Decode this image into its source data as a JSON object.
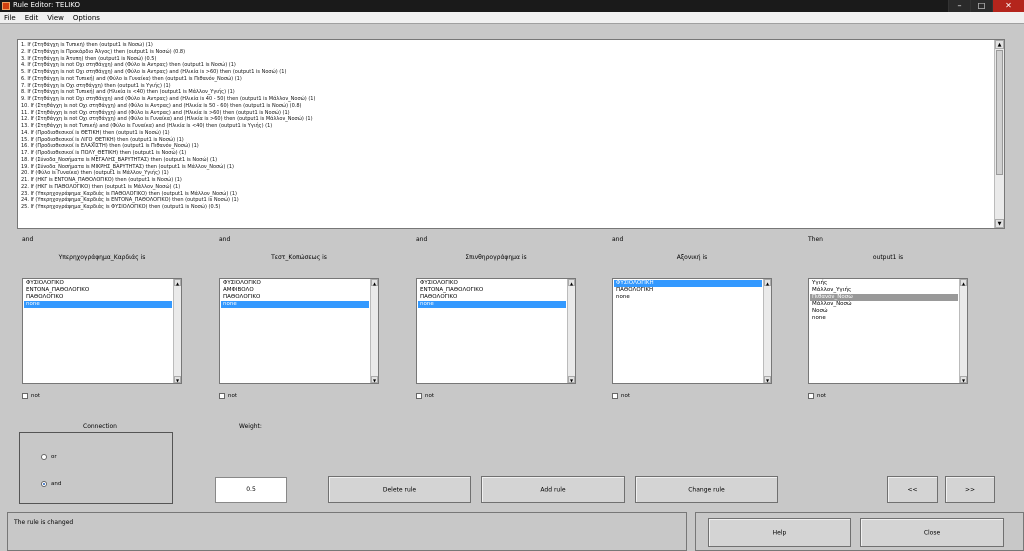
{
  "window": {
    "title": "Rule Editor: TELIKO",
    "min": "–",
    "max": "□",
    "close": "✕"
  },
  "menu": [
    "File",
    "Edit",
    "View",
    "Options"
  ],
  "rules": [
    "1. If (Στηθάγχη is Τυπική) then (output1 is Νοσώ) (1)",
    "2. If (Στηθάγχη is Προκάρδιο Άλγος) then (output1 is Νοσώ) (0.8)",
    "3. If (Στηθάγχη is Άτυπη) then (output1 is Νοσώ) (0.5)",
    "4. If (Στηθάγχη is not Οχι στηθάγχη) and (Φύλο is Αντρας) then (output1 is Νοσώ) (1)",
    "5. If (Στηθάγχη is not Οχι στηθάγχη) and (Φύλο is Αντρας) and (Ηλικία is >60) then (output1 is Νοσώ) (1)",
    "6. If (Στηθάγχη is not Τυπική) and (Φύλο is Γυναίκα) then (output1 is Πιθανόν_Νοσώ) (1)",
    "7. If (Στηθάγχη is Οχι στηθάγχη) then (output1 is Υγιής) (1)",
    "8. If (Στηθάγχη is not Τυπική) and (Ηλικία is <40) then (output1 is Μάλλον_Υγιής) (1)",
    "9. If (Στηθάγχη is not Οχι στηθάγχη) and (Φύλο is Αντρας) and (Ηλικία is 40 - 50) then (output1 is Μάλλον_Νοσώ) (1)",
    "10. If (Στηθάγχη is not Οχι στηθάγχη) and (Φύλο is Αντρας) and (Ηλικία is 50 - 60) then (output1 is Νοσώ) (0.8)",
    "11. If (Στηθάγχη is not Οχι στηθάγχη) and (Φύλο is Αντρας) and (Ηλικία is >60) then (output1 is Νοσώ) (1)",
    "12. If (Στηθάγχη is not Οχι στηθάγχη) and (Φύλο is Γυναίκα) and (Ηλικία is >60) then (output1 is Μάλλον_Νοσώ) (1)",
    "13. If (Στηθάγχη is not Τυπική) and (Φύλο is Γυναίκα) and (Ηλικία is <40) then (output1 is Υγιής) (1)",
    "14. If (Προδιαθεσικοί is ΘΕΤΙΚΗ) then (output1 is Νοσώ) (1)",
    "15. If (Προδιαθεσικοί is ΛΙΓΟ_ΘΕΤΙΚΗ) then (output1 is Νοσώ) (1)",
    "16. If (Προδιαθεσικοί is ΕΛΑΧΙΣΤΗ) then (output1 is Πιθανόν_Νοσώ) (1)",
    "17. If (Προδιαθεσικοί is ΠΟΛΥ_ΘΕΤΙΚΗ) then (output1 is Νοσώ) (1)",
    "18. If (Σύνοδα_Νοσήματα is ΜΕΓΑΛΗΣ_ΒΑΡΥΤΗΤΑΣ) then (output1 is Νοσώ) (1)",
    "19. If (Σύνοδα_Νοσήματα is ΜΙΚΡΗΣ_ΒΑΡΥΤΗΤΑΣ) then (output1 is Μάλλον_Νοσώ) (1)",
    "20. If (Φύλο is Γυναίκα) then (output1 is Μάλλον_Υγιής) (1)",
    "21. If (ΗΚΓ is ΕΝΤΟΝΑ_ΠΑΘΟΛΟΓΙΚΟ) then (output1 is Νοσώ) (1)",
    "22. If (ΗΚΓ is ΠΑΘΟΛΟΓΙΚΟ) then (output1 is Μάλλον_Νοσώ) (1)",
    "23. If (Υπερηχογράφημα_Καρδιάς is ΠΑΘΟΛΟΓΙΚΟ) then (output1 is Μάλλον_Νοσώ) (1)",
    "24. If (Υπερηχογράφημα_Καρδιάς is ΕΝΤΟΝΑ_ΠΑΘΟΛΟΓΙΚΟ) then (output1 is Νοσώ) (1)",
    "25. If (Υπερηχογράφημα_Καρδιάς is ΦΥΣΙΟΛΟΓΙΚΟ) then (output1 is Νοσώ) (0.5)"
  ],
  "columns": [
    {
      "conn": "and",
      "heading": "Υπερηχογράφημα_Καρδιάς is",
      "items": [
        "ΦΥΣΙΟΛΟΓΙΚΟ",
        "ΕΝΤΟΝΑ_ΠΑΘΟΛΟΓΙΚΟ",
        "ΠΑΘΟΛΟΓΙΚΟ",
        "none"
      ],
      "selected": 3,
      "not": "not"
    },
    {
      "conn": "and",
      "heading": "Τεστ_Κοπώσεως is",
      "items": [
        "ΦΥΣΙΟΛΟΓΙΚΟ",
        "ΑΜΦΙΒΟΛΟ",
        "ΠΑΘΟΛΟΓΙΚΟ",
        "none"
      ],
      "selected": 3,
      "not": "not"
    },
    {
      "conn": "and",
      "heading": "Σπινθηρογράφημα is",
      "items": [
        "ΦΥΣΙΟΛΟΓΙΚΟ",
        "ΕΝΤΟΝΑ_ΠΑΘΟΛΟΓΙΚΟ",
        "ΠΑΘΟΛΟΓΙΚΟ",
        "none"
      ],
      "selected": 3,
      "not": "not"
    },
    {
      "conn": "and",
      "heading": "Αξονική is",
      "items": [
        "ΦΥΣΙΟΛΟΓΙΚΗ",
        "ΠΑΘΟΛΟΓΙΚΗ",
        "none"
      ],
      "selected": 0,
      "not": "not"
    },
    {
      "conn": "Then",
      "heading": "output1 is",
      "items": [
        "Υγιής",
        "Μάλλον_Υγιής",
        "Πιθανόν_Νοσώ",
        "Μάλλον_Νοσώ",
        "Νοσώ",
        "none"
      ],
      "selected": 2,
      "selected_style": "gray",
      "not": "not"
    }
  ],
  "connection": {
    "title": "Connection",
    "or_label": "or",
    "and_label": "and",
    "selected": "and"
  },
  "weight": {
    "label": "Weight:",
    "value": "0.5"
  },
  "buttons": {
    "delete": "Delete rule",
    "add": "Add rule",
    "change": "Change rule",
    "prev": "<<",
    "next": ">>",
    "help": "Help",
    "close": "Close"
  },
  "status": "The rule is changed",
  "colors": {
    "selection": "#3399ff",
    "selection_inactive": "#999999",
    "background": "#c8c8c8"
  }
}
